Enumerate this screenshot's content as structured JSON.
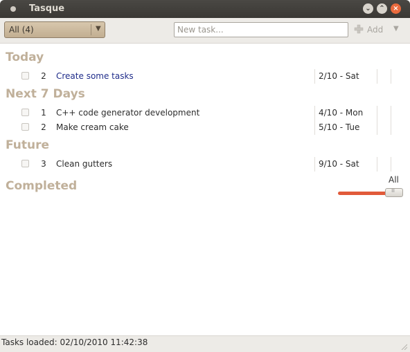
{
  "window": {
    "title": "Tasque"
  },
  "toolbar": {
    "filter_value": "All (4)",
    "new_task_placeholder": "New task...",
    "add_label": "Add"
  },
  "sections": {
    "today": {
      "label": "Today",
      "tasks": [
        {
          "priority": "2",
          "name": "Create some tasks",
          "due": "2/10 - Sat"
        }
      ]
    },
    "next7": {
      "label": "Next 7 Days",
      "tasks": [
        {
          "priority": "1",
          "name": "C++ code generator development",
          "due": "4/10 - Mon"
        },
        {
          "priority": "2",
          "name": "Make cream cake",
          "due": "5/10 - Tue"
        }
      ]
    },
    "future": {
      "label": "Future",
      "tasks": [
        {
          "priority": "3",
          "name": "Clean gutters",
          "due": "9/10 - Sat"
        }
      ]
    },
    "completed": {
      "label": "Completed",
      "range_label": "All",
      "slider_position_fraction": 0.73
    }
  },
  "statusbar": {
    "text": "Tasks loaded: 02/10/2010 11:42:38"
  },
  "colors": {
    "section_heading": "#c0b09a",
    "link_task": "#1f2c8a",
    "slider_fill": "#e15a3a"
  },
  "icons": [
    "app-menu-icon",
    "minimize-icon",
    "maximize-icon",
    "close-icon",
    "dropdown-arrow-icon",
    "add-icon",
    "resize-grip-icon"
  ]
}
